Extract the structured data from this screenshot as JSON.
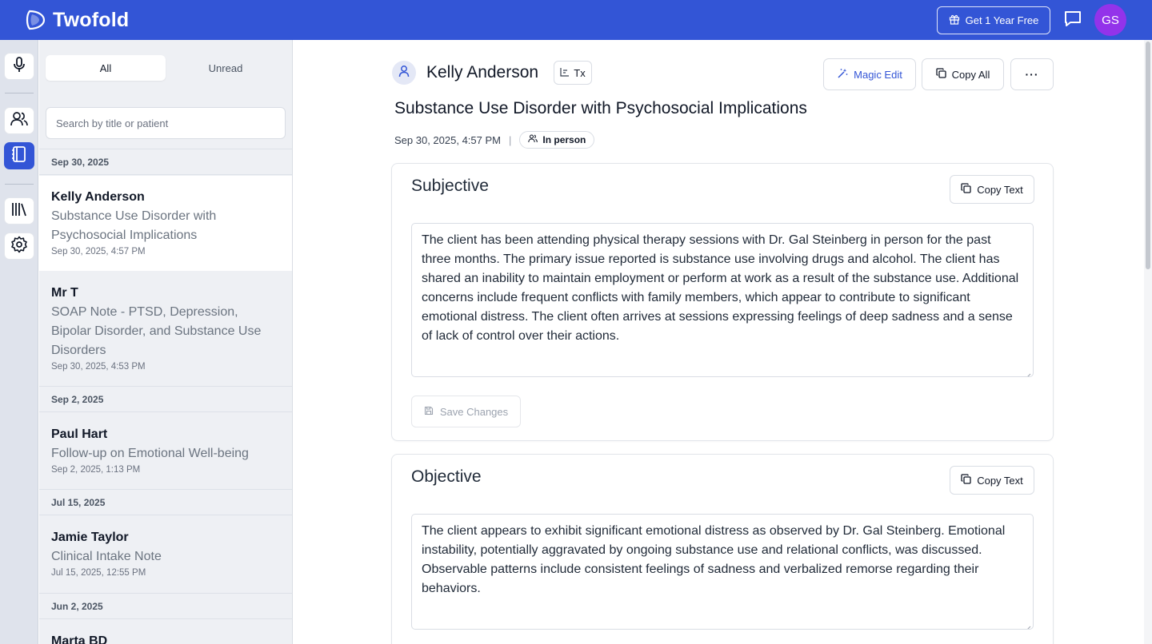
{
  "app": {
    "brand": "Twofold",
    "promo_label": "Get 1 Year Free",
    "user_initials": "GS",
    "colors": {
      "brand_blue": "#3355d6",
      "avatar_purple": "#9333ea",
      "muted_text": "#6b7480"
    }
  },
  "rail": {
    "items": [
      {
        "icon": "microphone-icon"
      },
      {
        "icon": "patients-icon"
      },
      {
        "icon": "notebook-icon",
        "active": true
      },
      {
        "icon": "library-icon"
      },
      {
        "icon": "gear-icon"
      }
    ]
  },
  "list": {
    "tabs": [
      "All",
      "Unread"
    ],
    "active_tab": "All",
    "search_placeholder": "Search by title or patient",
    "groups": [
      {
        "date": "Sep 30, 2025",
        "notes": [
          {
            "name": "Kelly Anderson",
            "title": "Substance Use Disorder with Psychosocial Implications",
            "time": "Sep 30, 2025, 4:57 PM",
            "selected": true
          },
          {
            "name": "Mr T",
            "title": "SOAP Note - PTSD, Depression, Bipolar Disorder, and Substance Use Disorders",
            "time": "Sep 30, 2025, 4:53 PM"
          }
        ]
      },
      {
        "date": "Sep 2, 2025",
        "notes": [
          {
            "name": "Paul Hart",
            "title": "Follow-up on Emotional Well-being",
            "time": "Sep 2, 2025, 1:13 PM"
          }
        ]
      },
      {
        "date": "Jul 15, 2025",
        "notes": [
          {
            "name": "Jamie Taylor",
            "title": "Clinical Intake Note",
            "time": "Jul 15, 2025, 12:55 PM"
          }
        ]
      },
      {
        "date": "Jun 2, 2025",
        "notes": [
          {
            "name": "Marta BD",
            "title": "",
            "time": ""
          }
        ]
      }
    ]
  },
  "note": {
    "patient_name": "Kelly Anderson",
    "tx_label": "Tx",
    "magic_edit_label": "Magic Edit",
    "copy_all_label": "Copy All",
    "more_label": "···",
    "title": "Substance Use Disorder with Psychosocial Implications",
    "datetime": "Sep 30, 2025, 4:57 PM",
    "separator": "|",
    "visit_type": "In person",
    "sections": [
      {
        "heading": "Subjective",
        "copy_label": "Copy Text",
        "text": "The client has been attending physical therapy sessions with Dr. Gal Steinberg in person for the past three months. The primary issue reported is substance use involving drugs and alcohol. The client has shared an inability to maintain employment or perform at work as a result of the substance use. Additional concerns include frequent conflicts with family members, which appear to contribute to significant emotional distress. The client often arrives at sessions expressing feelings of deep sadness and a sense of lack of control over their actions.",
        "save_label": "Save Changes"
      },
      {
        "heading": "Objective",
        "copy_label": "Copy Text",
        "text": "The client appears to exhibit significant emotional distress as observed by Dr. Gal Steinberg. Emotional instability, potentially aggravated by ongoing substance use and relational conflicts, was discussed. Observable patterns include consistent feelings of sadness and verbalized remorse regarding their behaviors."
      }
    ]
  }
}
